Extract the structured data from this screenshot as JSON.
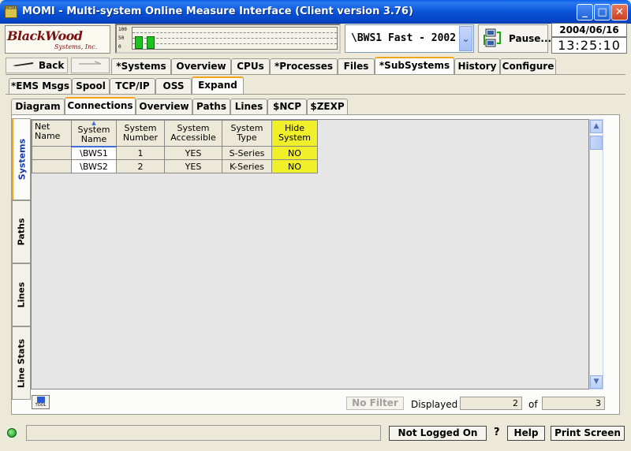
{
  "window": {
    "title": "MOMI - Multi-system Online Measure Interface (Client version 3.76)",
    "icon_text": "MOMI",
    "minimize": "_",
    "maximize": "□",
    "close": "✕"
  },
  "logo": {
    "name": "BlackWood",
    "sub": "Systems, Inc."
  },
  "graph": {
    "labels": [
      "100",
      "50",
      "0"
    ],
    "bars": [
      0.6,
      0.6
    ]
  },
  "system_selector": {
    "value": "\\BWS1 Fast - 2002"
  },
  "pause_label": "Pause...",
  "date": "2004/06/16",
  "time": "13:25:10",
  "nav": {
    "back_label": "Back"
  },
  "main_tabs": [
    "*Systems",
    "Overview",
    "CPUs",
    "*Processes",
    "Files",
    "*SubSystems",
    "History",
    "Configure"
  ],
  "sub_tabs": [
    "*EMS Msgs",
    "Spool",
    "TCP/IP",
    "OSS",
    "Expand"
  ],
  "expand_tabs": [
    "Diagram",
    "Connections",
    "Overview",
    "Paths",
    "Lines",
    "$NCP",
    "$ZEXP"
  ],
  "side_tabs": [
    "Systems",
    "Paths",
    "Lines",
    "Line Stats"
  ],
  "table": {
    "headers": [
      "Net Name",
      "System Name",
      "System Number",
      "System Accessible",
      "System Type",
      "Hide System"
    ],
    "rows": [
      [
        "",
        "\\BWS1",
        "1",
        "YES",
        "S-Series",
        "NO"
      ],
      [
        "",
        "\\BWS2",
        "2",
        "YES",
        "K-Series",
        "NO"
      ]
    ]
  },
  "footer": {
    "tool_label": "TOOL",
    "no_filter": "No Filter",
    "displayed_label": "Displayed",
    "displayed_value": "2",
    "of_label": "of",
    "total_value": "3"
  },
  "statusbar": {
    "login": "Not Logged On",
    "question": "?",
    "help": "Help",
    "print": "Print Screen"
  },
  "colors": {
    "titlebar": "#0a53d8",
    "highlight": "#f0ef2a",
    "active_tab": "#f6a31c"
  }
}
